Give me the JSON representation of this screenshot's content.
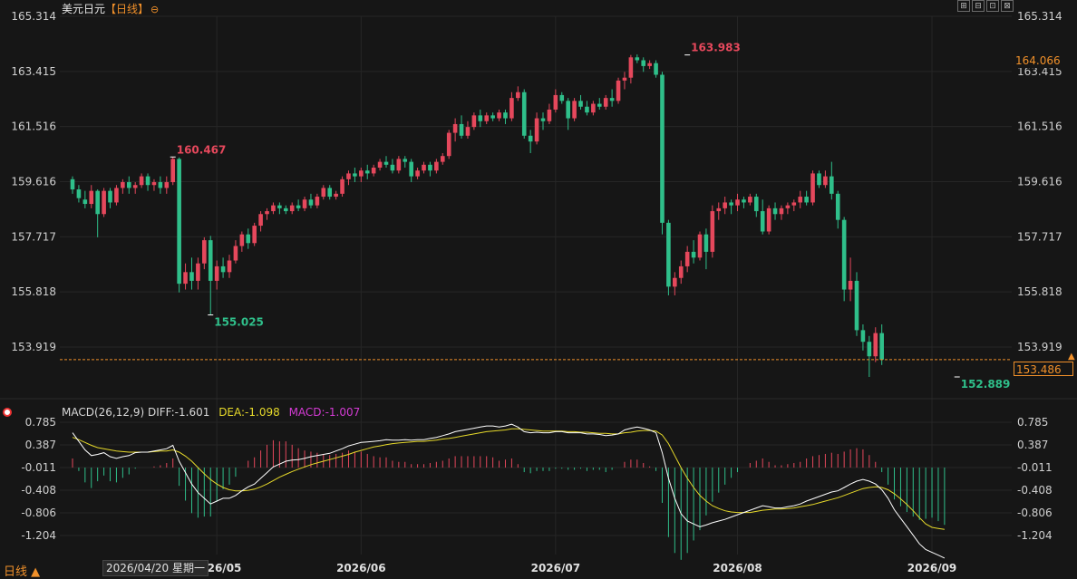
{
  "header": {
    "instrument": "美元日元",
    "period": "【日线】",
    "icon": "crosshair-icon"
  },
  "window_buttons": [
    "⊞",
    "⊟",
    "⊡",
    "⊠"
  ],
  "price_tags": {
    "last_price": "164.066",
    "current_line": "153.486"
  },
  "macd_header": {
    "params": "MACD(26,12,9)",
    "diff": "DIFF:-1.601",
    "dea": "DEA:-1.098",
    "macd": "MACD:-1.007"
  },
  "footer": {
    "period_button": "日线 ▲",
    "date_tip": "2026/04/20 星期一"
  },
  "colors": {
    "up": "#e5485c",
    "down": "#2fbf8a",
    "diff": "#ffffff",
    "dea": "#e6d92a",
    "bg": "#161616"
  },
  "chart_data": [
    {
      "type": "candlestick",
      "title": "美元日元",
      "y_ticks": [
        "165.314",
        "163.415",
        "161.516",
        "159.616",
        "157.717",
        "155.818",
        "153.919"
      ],
      "ylim": [
        152.6,
        165.4
      ],
      "x_ticks": [
        {
          "label": "2026/05",
          "index": 23
        },
        {
          "label": "2026/06",
          "index": 46
        },
        {
          "label": "2026/07",
          "index": 77
        },
        {
          "label": "2026/08",
          "index": 106
        },
        {
          "label": "2026/09",
          "index": 137
        }
      ],
      "annotations": [
        {
          "label": "160.467",
          "index": 16,
          "value": 160.467,
          "kind": "high"
        },
        {
          "label": "155.025",
          "index": 22,
          "value": 155.025,
          "kind": "low"
        },
        {
          "label": "163.983",
          "index": 98,
          "value": 163.983,
          "kind": "high"
        },
        {
          "label": "152.889",
          "index": 141,
          "value": 152.889,
          "kind": "low"
        }
      ],
      "current_price": 153.486,
      "ohlc": [
        [
          159.7,
          159.8,
          159.2,
          159.35
        ],
        [
          159.35,
          159.5,
          158.9,
          159.05
        ],
        [
          159.0,
          159.3,
          158.7,
          158.85
        ],
        [
          158.85,
          159.5,
          158.7,
          159.3
        ],
        [
          159.3,
          159.35,
          157.7,
          158.5
        ],
        [
          158.5,
          159.4,
          158.4,
          159.3
        ],
        [
          159.3,
          159.4,
          158.7,
          158.9
        ],
        [
          158.9,
          159.5,
          158.8,
          159.4
        ],
        [
          159.4,
          159.7,
          159.2,
          159.6
        ],
        [
          159.6,
          159.8,
          159.2,
          159.4
        ],
        [
          159.4,
          159.6,
          159.2,
          159.5
        ],
        [
          159.5,
          159.9,
          159.4,
          159.8
        ],
        [
          159.8,
          159.9,
          159.3,
          159.5
        ],
        [
          159.5,
          159.7,
          159.3,
          159.6
        ],
        [
          159.6,
          159.8,
          159.2,
          159.4
        ],
        [
          159.4,
          159.8,
          159.2,
          159.6
        ],
        [
          159.6,
          160.467,
          159.5,
          160.4
        ],
        [
          160.4,
          160.45,
          155.8,
          156.1
        ],
        [
          156.1,
          156.8,
          155.9,
          156.5
        ],
        [
          156.5,
          157.0,
          155.9,
          156.2
        ],
        [
          156.2,
          157.0,
          155.9,
          156.8
        ],
        [
          156.8,
          157.7,
          156.6,
          157.6
        ],
        [
          157.6,
          157.75,
          155.025,
          156.2
        ],
        [
          156.2,
          156.9,
          155.9,
          156.7
        ],
        [
          156.7,
          157.0,
          156.3,
          156.5
        ],
        [
          156.5,
          157.1,
          156.3,
          156.9
        ],
        [
          156.9,
          157.6,
          156.8,
          157.4
        ],
        [
          157.4,
          157.9,
          157.2,
          157.8
        ],
        [
          157.8,
          158.0,
          157.3,
          157.5
        ],
        [
          157.5,
          158.2,
          157.4,
          158.1
        ],
        [
          158.1,
          158.6,
          157.9,
          158.5
        ],
        [
          158.5,
          158.7,
          158.3,
          158.6
        ],
        [
          158.6,
          158.9,
          158.5,
          158.8
        ],
        [
          158.8,
          158.9,
          158.5,
          158.7
        ],
        [
          158.7,
          158.8,
          158.5,
          158.6
        ],
        [
          158.6,
          158.9,
          158.5,
          158.8
        ],
        [
          158.8,
          159.0,
          158.6,
          158.7
        ],
        [
          158.7,
          159.1,
          158.6,
          159.0
        ],
        [
          159.0,
          159.2,
          158.7,
          158.8
        ],
        [
          158.8,
          159.2,
          158.7,
          159.1
        ],
        [
          159.1,
          159.5,
          159.0,
          159.4
        ],
        [
          159.4,
          159.5,
          159.0,
          159.1
        ],
        [
          159.1,
          159.3,
          159.0,
          159.2
        ],
        [
          159.2,
          159.8,
          159.1,
          159.7
        ],
        [
          159.7,
          160.0,
          159.5,
          159.9
        ],
        [
          159.9,
          160.1,
          159.6,
          159.8
        ],
        [
          159.8,
          160.1,
          159.6,
          160.0
        ],
        [
          160.0,
          160.2,
          159.7,
          159.9
        ],
        [
          159.9,
          160.2,
          159.8,
          160.1
        ],
        [
          160.1,
          160.4,
          160.0,
          160.3
        ],
        [
          160.3,
          160.5,
          160.1,
          160.2
        ],
        [
          160.2,
          160.4,
          159.9,
          160.0
        ],
        [
          160.0,
          160.5,
          159.9,
          160.4
        ],
        [
          160.4,
          160.5,
          160.1,
          160.3
        ],
        [
          160.3,
          160.4,
          159.6,
          159.8
        ],
        [
          159.8,
          160.1,
          159.7,
          160.0
        ],
        [
          160.0,
          160.3,
          159.9,
          160.2
        ],
        [
          160.2,
          160.3,
          159.8,
          160.0
        ],
        [
          160.0,
          160.4,
          159.9,
          160.3
        ],
        [
          160.3,
          160.6,
          160.2,
          160.5
        ],
        [
          160.5,
          161.4,
          160.4,
          161.3
        ],
        [
          161.3,
          161.8,
          161.0,
          161.6
        ],
        [
          161.6,
          161.9,
          161.1,
          161.2
        ],
        [
          161.2,
          161.7,
          161.1,
          161.5
        ],
        [
          161.5,
          162.0,
          161.4,
          161.9
        ],
        [
          161.9,
          162.1,
          161.5,
          161.7
        ],
        [
          161.7,
          162.0,
          161.6,
          161.9
        ],
        [
          161.9,
          162.0,
          161.7,
          161.8
        ],
        [
          161.8,
          162.1,
          161.7,
          162.0
        ],
        [
          162.0,
          162.1,
          161.6,
          161.8
        ],
        [
          161.8,
          162.7,
          161.7,
          162.5
        ],
        [
          162.5,
          162.9,
          162.4,
          162.7
        ],
        [
          162.7,
          162.8,
          161.1,
          161.2
        ],
        [
          161.2,
          161.4,
          160.6,
          161.0
        ],
        [
          161.0,
          162.0,
          160.9,
          161.8
        ],
        [
          161.8,
          162.0,
          161.4,
          161.7
        ],
        [
          161.7,
          162.3,
          161.6,
          162.1
        ],
        [
          162.1,
          162.8,
          162.0,
          162.6
        ],
        [
          162.6,
          162.7,
          162.3,
          162.4
        ],
        [
          162.4,
          162.5,
          161.4,
          161.8
        ],
        [
          161.8,
          162.5,
          161.7,
          162.4
        ],
        [
          162.4,
          162.6,
          162.1,
          162.2
        ],
        [
          162.2,
          162.4,
          161.9,
          162.0
        ],
        [
          162.0,
          162.4,
          161.9,
          162.3
        ],
        [
          162.3,
          162.5,
          162.1,
          162.2
        ],
        [
          162.2,
          162.6,
          162.1,
          162.5
        ],
        [
          162.5,
          162.8,
          162.2,
          162.4
        ],
        [
          162.4,
          163.2,
          162.3,
          163.1
        ],
        [
          163.1,
          163.4,
          162.8,
          163.2
        ],
        [
          163.2,
          163.983,
          163.0,
          163.9
        ],
        [
          163.9,
          164.0,
          163.7,
          163.8
        ],
        [
          163.8,
          163.9,
          163.4,
          163.6
        ],
        [
          163.6,
          163.8,
          163.5,
          163.7
        ],
        [
          163.7,
          163.8,
          163.2,
          163.3
        ],
        [
          163.3,
          163.4,
          157.8,
          158.2
        ],
        [
          158.2,
          158.3,
          155.7,
          156.0
        ],
        [
          156.0,
          156.5,
          155.7,
          156.3
        ],
        [
          156.3,
          156.9,
          156.1,
          156.7
        ],
        [
          156.7,
          157.4,
          156.5,
          157.2
        ],
        [
          157.2,
          157.6,
          156.8,
          157.0
        ],
        [
          157.0,
          157.9,
          156.9,
          157.8
        ],
        [
          157.8,
          158.0,
          156.6,
          157.2
        ],
        [
          157.2,
          158.8,
          157.0,
          158.6
        ],
        [
          158.6,
          158.9,
          158.3,
          158.7
        ],
        [
          158.7,
          159.1,
          158.5,
          158.9
        ],
        [
          158.9,
          159.0,
          158.5,
          158.8
        ],
        [
          158.8,
          159.2,
          158.6,
          159.0
        ],
        [
          159.0,
          159.1,
          158.7,
          158.9
        ],
        [
          158.9,
          159.2,
          158.8,
          159.1
        ],
        [
          159.1,
          159.2,
          158.4,
          158.6
        ],
        [
          158.6,
          159.0,
          157.8,
          157.9
        ],
        [
          157.9,
          158.8,
          157.8,
          158.7
        ],
        [
          158.7,
          158.9,
          158.3,
          158.5
        ],
        [
          158.5,
          158.8,
          158.3,
          158.7
        ],
        [
          158.7,
          158.9,
          158.5,
          158.8
        ],
        [
          158.8,
          159.0,
          158.6,
          158.9
        ],
        [
          158.9,
          159.3,
          158.7,
          159.1
        ],
        [
          159.1,
          159.3,
          158.8,
          158.9
        ],
        [
          158.9,
          160.0,
          158.8,
          159.9
        ],
        [
          159.9,
          160.0,
          159.4,
          159.5
        ],
        [
          159.5,
          160.0,
          159.4,
          159.8
        ],
        [
          159.8,
          160.3,
          159.0,
          159.2
        ],
        [
          159.2,
          159.3,
          158.0,
          158.3
        ],
        [
          158.3,
          158.4,
          155.5,
          155.9
        ],
        [
          155.9,
          157.0,
          155.5,
          156.2
        ],
        [
          156.2,
          156.5,
          154.3,
          154.5
        ],
        [
          154.5,
          154.7,
          153.8,
          154.1
        ],
        [
          154.1,
          154.3,
          152.889,
          153.6
        ],
        [
          153.6,
          154.6,
          153.4,
          154.4
        ],
        [
          154.4,
          154.7,
          153.3,
          153.486
        ]
      ]
    },
    {
      "type": "macd",
      "title": "MACD(26,12,9)",
      "y_ticks": [
        "0.785",
        "0.387",
        "-0.011",
        "-0.408",
        "-0.806",
        "-1.204"
      ],
      "ylim": [
        -1.55,
        0.95
      ],
      "series": [
        {
          "name": "DIFF",
          "values": [
            0.6,
            0.45,
            0.3,
            0.2,
            0.22,
            0.25,
            0.18,
            0.15,
            0.18,
            0.2,
            0.25,
            0.26,
            0.26,
            0.28,
            0.3,
            0.32,
            0.38,
            0.1,
            -0.1,
            -0.3,
            -0.45,
            -0.55,
            -0.65,
            -0.6,
            -0.55,
            -0.55,
            -0.5,
            -0.42,
            -0.35,
            -0.3,
            -0.2,
            -0.1,
            0.0,
            0.05,
            0.1,
            0.12,
            0.13,
            0.15,
            0.18,
            0.2,
            0.22,
            0.24,
            0.28,
            0.32,
            0.37,
            0.4,
            0.43,
            0.44,
            0.45,
            0.46,
            0.48,
            0.47,
            0.47,
            0.48,
            0.47,
            0.48,
            0.48,
            0.5,
            0.52,
            0.55,
            0.58,
            0.62,
            0.64,
            0.66,
            0.68,
            0.7,
            0.72,
            0.72,
            0.7,
            0.72,
            0.75,
            0.7,
            0.62,
            0.6,
            0.61,
            0.6,
            0.6,
            0.62,
            0.62,
            0.6,
            0.6,
            0.6,
            0.58,
            0.58,
            0.57,
            0.55,
            0.56,
            0.58,
            0.65,
            0.68,
            0.7,
            0.68,
            0.65,
            0.6,
            0.25,
            -0.2,
            -0.55,
            -0.82,
            -0.95,
            -1.0,
            -1.05,
            -1.02,
            -0.98,
            -0.95,
            -0.92,
            -0.88,
            -0.84,
            -0.8,
            -0.76,
            -0.72,
            -0.68,
            -0.7,
            -0.72,
            -0.72,
            -0.7,
            -0.68,
            -0.65,
            -0.6,
            -0.56,
            -0.52,
            -0.48,
            -0.44,
            -0.42,
            -0.36,
            -0.3,
            -0.25,
            -0.22,
            -0.25,
            -0.3,
            -0.4,
            -0.55,
            -0.75,
            -0.9,
            -1.05,
            -1.2,
            -1.35,
            -1.45,
            -1.5,
            -1.55,
            -1.601
          ]
        },
        {
          "name": "DEA",
          "values": [
            0.52,
            0.48,
            0.43,
            0.38,
            0.34,
            0.32,
            0.3,
            0.28,
            0.27,
            0.26,
            0.26,
            0.26,
            0.26,
            0.27,
            0.28,
            0.28,
            0.3,
            0.26,
            0.19,
            0.1,
            -0.01,
            -0.12,
            -0.22,
            -0.3,
            -0.36,
            -0.4,
            -0.42,
            -0.42,
            -0.41,
            -0.39,
            -0.35,
            -0.3,
            -0.24,
            -0.18,
            -0.13,
            -0.08,
            -0.04,
            -0.0,
            0.04,
            0.07,
            0.1,
            0.13,
            0.16,
            0.19,
            0.22,
            0.26,
            0.29,
            0.32,
            0.35,
            0.37,
            0.39,
            0.41,
            0.42,
            0.43,
            0.44,
            0.45,
            0.45,
            0.46,
            0.47,
            0.49,
            0.5,
            0.52,
            0.54,
            0.56,
            0.58,
            0.6,
            0.62,
            0.63,
            0.64,
            0.65,
            0.67,
            0.67,
            0.66,
            0.65,
            0.64,
            0.63,
            0.63,
            0.63,
            0.63,
            0.62,
            0.62,
            0.61,
            0.61,
            0.6,
            0.59,
            0.59,
            0.58,
            0.58,
            0.6,
            0.61,
            0.63,
            0.64,
            0.64,
            0.63,
            0.56,
            0.41,
            0.2,
            -0.01,
            -0.2,
            -0.36,
            -0.5,
            -0.6,
            -0.68,
            -0.73,
            -0.77,
            -0.79,
            -0.8,
            -0.8,
            -0.8,
            -0.78,
            -0.76,
            -0.75,
            -0.74,
            -0.74,
            -0.73,
            -0.72,
            -0.7,
            -0.68,
            -0.66,
            -0.63,
            -0.6,
            -0.57,
            -0.54,
            -0.5,
            -0.46,
            -0.42,
            -0.38,
            -0.36,
            -0.35,
            -0.36,
            -0.4,
            -0.47,
            -0.56,
            -0.66,
            -0.77,
            -0.89,
            -1.0,
            -1.06,
            -1.08,
            -1.098
          ]
        }
      ]
    }
  ]
}
